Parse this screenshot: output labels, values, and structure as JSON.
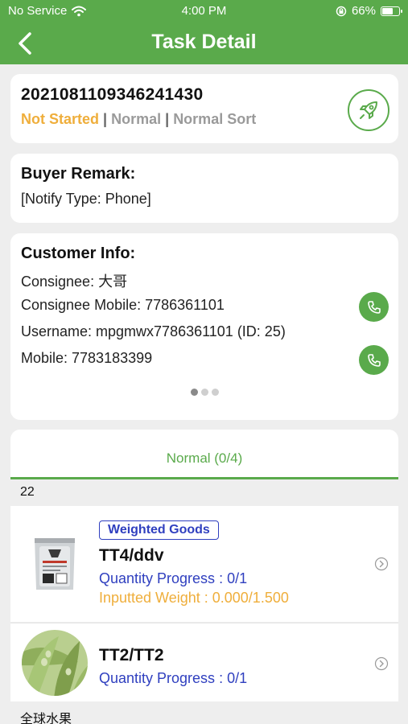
{
  "status_bar": {
    "carrier": "No Service",
    "time": "4:00 PM",
    "battery_percent": "66%",
    "battery_level": 0.66,
    "icons": [
      "wifi-icon",
      "orientation-lock-icon",
      "battery-charging-icon"
    ]
  },
  "nav": {
    "title": "Task Detail",
    "back_icon": "chevron-left-icon"
  },
  "order": {
    "id": "2021081109346241430",
    "status": "Not Started",
    "separator": "|",
    "type": "Normal",
    "sort": "Normal Sort",
    "action_icon": "rocket-icon"
  },
  "buyer_remark": {
    "title": "Buyer Remark:",
    "text": "[Notify Type: Phone]"
  },
  "customer": {
    "title": "Customer Info:",
    "consignee": "Consignee: 大哥",
    "consignee_mobile": "Consignee Mobile: 7786361101",
    "username": "Username: mpgmwx7786361101 (ID: 25)",
    "mobile": "Mobile: 7783183399",
    "call_icon": "phone-icon",
    "pager": {
      "pages": 3,
      "active": 1
    }
  },
  "tabs": {
    "active_label": "Normal (0/4)"
  },
  "groups": [
    {
      "label": "22",
      "items": [
        {
          "badge": "Weighted Goods",
          "name": "TT4/ddv",
          "quantity": "Quantity Progress : 0/1",
          "weight": "Inputted Weight : 0.000/1.500",
          "image": "packaged-product-bag"
        },
        {
          "name": "TT2/TT2",
          "quantity": "Quantity Progress : 0/1",
          "image": "green-beans-photo"
        }
      ]
    },
    {
      "label": "全球水果"
    }
  ],
  "colors": {
    "brand_green": "#5aaa4b",
    "status_orange": "#efae3b",
    "link_blue": "#2f3fbf",
    "muted_gray": "#9a9a9a",
    "background": "#eeeeee"
  }
}
